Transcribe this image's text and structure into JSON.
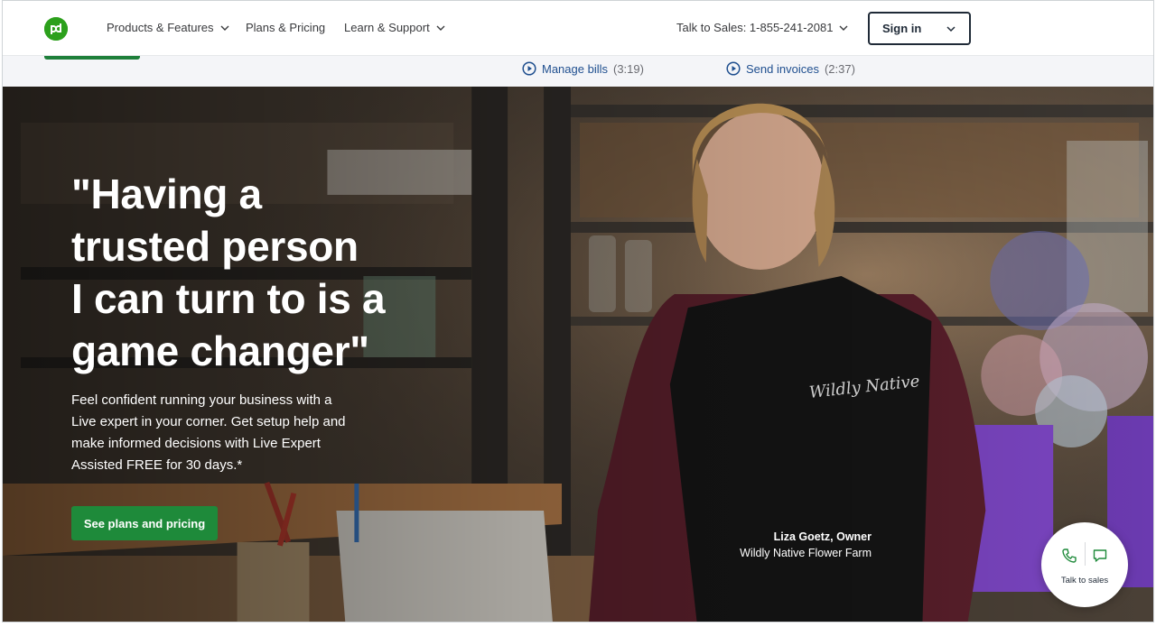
{
  "nav": {
    "items": [
      {
        "label": "Products & Features",
        "has_dropdown": true
      },
      {
        "label": "Plans & Pricing",
        "has_dropdown": false
      },
      {
        "label": "Learn & Support",
        "has_dropdown": true
      }
    ],
    "sales_label": "Talk to Sales: 1-855-241-2081",
    "signin_label": "Sign in"
  },
  "videos": [
    {
      "label": "Manage bills",
      "duration": "(3:19)"
    },
    {
      "label": "Send invoices",
      "duration": "(2:37)"
    }
  ],
  "hero": {
    "headline_lines": [
      "\"Having a",
      "trusted person",
      "I can turn to is a",
      "game changer\""
    ],
    "subtext_lines": [
      "Feel confident running your business with a",
      "Live expert in your corner. Get setup help and",
      "make informed decisions with Live Expert",
      "Assisted FREE for 30 days.*"
    ],
    "cta_label": "See plans and pricing",
    "caption_name": "Liza Goetz, Owner",
    "caption_company": "Wildly Native Flower Farm"
  },
  "contact": {
    "label": "Talk to sales"
  },
  "colors": {
    "brand_green": "#2ca01c",
    "cta_green": "#1e8a3a",
    "link_blue": "#1f4f8f"
  },
  "icons": [
    "quickbooks-logo-icon",
    "chevron-down-icon",
    "play-circle-icon",
    "phone-icon",
    "chat-icon"
  ]
}
